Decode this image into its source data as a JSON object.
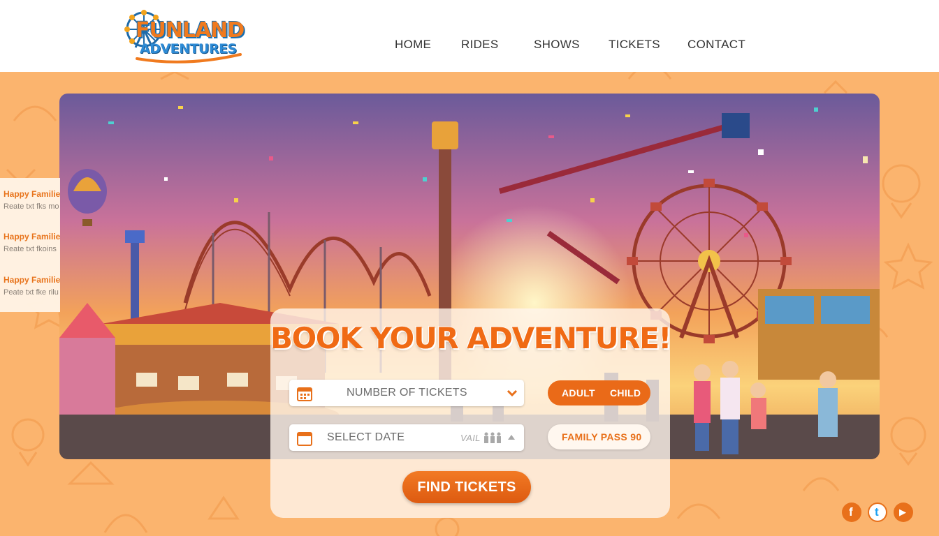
{
  "brand": {
    "line1": "FUNLAND",
    "line2": "ADVENTURES",
    "primary_color": "#f07a1e",
    "accent_color": "#2d8bd6"
  },
  "nav": {
    "items": [
      "HOME",
      "RIDES",
      "SHOWS",
      "TICKETS",
      "CONTACT"
    ]
  },
  "testimonials": [
    {
      "title": "Happy Families",
      "text": "Reate txt fks mo"
    },
    {
      "title": "Happy Families",
      "text": "Reate txt fkoins"
    },
    {
      "title": "Happy Families",
      "text": "Peate txt fke rilu"
    }
  ],
  "booking": {
    "title": "BOOK YOUR ADVENTURE!",
    "tickets_placeholder": "NUMBER OF TICKETS",
    "date_placeholder": "SELECT DATE",
    "date_hint": "VAIL",
    "ticket_types": [
      "ADULT",
      "CHILD"
    ],
    "family_pass": "FAMILY PASS 90",
    "find_button": "FIND TICKETS",
    "button_color": "#ea6a18"
  },
  "social": {
    "icons": [
      "facebook-icon",
      "twitter-icon",
      "youtube-icon"
    ],
    "glyphs": [
      "f",
      "t",
      "▶"
    ]
  }
}
